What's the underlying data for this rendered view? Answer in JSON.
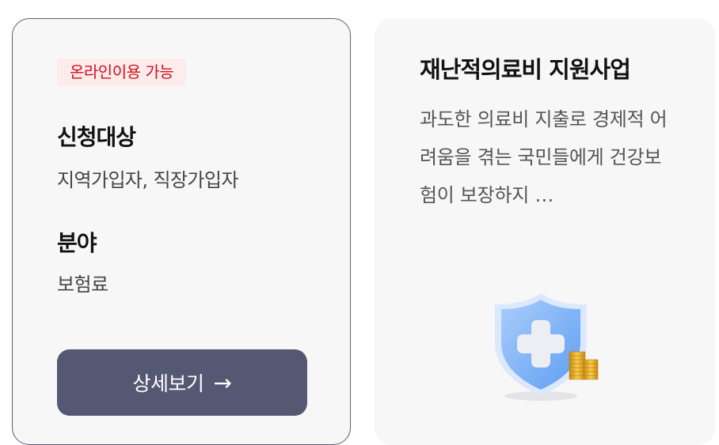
{
  "left_card": {
    "badge": "온라인이용 가능",
    "target_label": "신청대상",
    "target_value": "지역가입자, 직장가입자",
    "field_label": "분야",
    "field_value": "보험료",
    "detail_button": "상세보기",
    "arrow": "→"
  },
  "right_card": {
    "title": "재난적의료비 지원사업",
    "description": "과도한 의료비 지출로 경제적 어려움을 겪는 국민들에게 건강보험이 보장하지 …",
    "icon": "shield-cross-coins-icon"
  },
  "colors": {
    "badge_text": "#d10f1b",
    "badge_bg": "#fdecec",
    "button_bg": "#555872",
    "card_bg": "#f7f7f8"
  }
}
